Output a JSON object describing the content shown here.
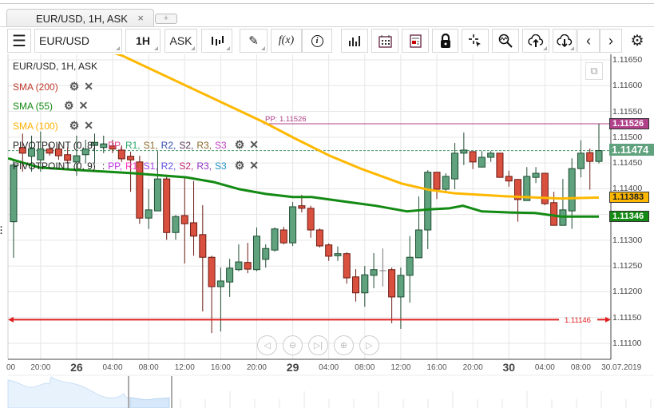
{
  "tab": {
    "title": "EUR/USD, 1H, ASK",
    "close": "×",
    "new": "+"
  },
  "toolbar": {
    "symbol": "EUR/USD",
    "timeframe": "1H",
    "side": "ASK",
    "fx": "f(x)",
    "icons": [
      "menu-icon",
      "candlestick-icon",
      "pencil-icon",
      "function-icon",
      "info-icon",
      "bar-chart-icon",
      "calendar-icon",
      "news-icon",
      "lock-icon",
      "crosshair-icon",
      "zoom-chart-icon",
      "upload-cloud-icon",
      "download-cloud-icon",
      "chevron-left-icon",
      "chevron-right-icon",
      "gear-icon"
    ]
  },
  "legend": {
    "title": "EUR/USD, 1H, ASK",
    "sma200": "SMA (200)",
    "sma55": "SMA (55)",
    "sma100": "SMA (100)",
    "pivot1": {
      "name": "PIVOTPOINT (0, 8)",
      "sep": ":",
      "items": [
        "PP,",
        "R1,",
        "S1,",
        "R2,",
        "S2,",
        "R3,",
        "S3"
      ],
      "colors": [
        "#e0408a",
        "#2aa86b",
        "#8a6a2a",
        "#3a4fb0",
        "#5a3a5a",
        "#8a6a2a",
        "#c040c0"
      ]
    },
    "pivot2": {
      "name": "PIVOTPOINT (0, 9)",
      "sep": ":",
      "items": [
        "PP,",
        "R1,",
        "S1,",
        "R2,",
        "S2,",
        "R3,",
        "S3"
      ],
      "colors": [
        "#c030e0",
        "#ff30c0",
        "#a040e0",
        "#6050e0",
        "#c02070",
        "#9030c0",
        "#2090c0"
      ]
    },
    "gear": "⚙",
    "close": "✕"
  },
  "colors": {
    "up": "#5fa27d",
    "down": "#d9503f",
    "sma100": "#ffb800",
    "sma55": "#138a13",
    "pp": "#b0408a",
    "support": "#e02020"
  },
  "chart": {
    "price_labels": [
      "1.11650",
      "1.11600",
      "1.11550",
      "1.11500",
      "1.11450",
      "1.11400",
      "1.11300",
      "1.11250",
      "1.11200",
      "1.11150",
      "1.11100"
    ],
    "time_labels": [
      {
        "t": "00",
        "i": -1.6
      },
      {
        "t": "20:00",
        "i": 3
      },
      {
        "t": "26",
        "i": 7,
        "bold": true
      },
      {
        "t": "04:00",
        "i": 11
      },
      {
        "t": "08:00",
        "i": 15
      },
      {
        "t": "12:00",
        "i": 19
      },
      {
        "t": "16:00",
        "i": 23
      },
      {
        "t": "20:00",
        "i": 27
      },
      {
        "t": "29",
        "i": 31,
        "bold": true
      },
      {
        "t": "04:00",
        "i": 35
      },
      {
        "t": "08:00",
        "i": 39
      },
      {
        "t": "12:00",
        "i": 43
      },
      {
        "t": "16:00",
        "i": 47
      },
      {
        "t": "20:00",
        "i": 51
      },
      {
        "t": "30",
        "i": 55,
        "bold": true
      },
      {
        "t": "04:00",
        "i": 59
      },
      {
        "t": "08:00",
        "i": 63
      },
      {
        "t": "30.07.2019",
        "i": 67.5
      }
    ],
    "last_price": "1.11474",
    "pp_value": "1.11526",
    "pp_label": "PP: 1.11526",
    "sma100_value": "1.11383",
    "sma55_value": "1.11346",
    "support_value": "1.11146",
    "candles_ohlc": [
      [
        1.11336,
        1.11456,
        1.11266,
        1.11446
      ],
      [
        1.1148,
        1.11507,
        1.11433,
        1.11469
      ],
      [
        1.11463,
        1.11503,
        1.11433,
        1.11478
      ],
      [
        1.11456,
        1.11511,
        1.11433,
        1.11477
      ],
      [
        1.11477,
        1.11487,
        1.11464,
        1.11469
      ],
      [
        1.11477,
        1.11487,
        1.11456,
        1.11464
      ],
      [
        1.11466,
        1.1148,
        1.11449,
        1.11455
      ],
      [
        1.11452,
        1.11503,
        1.11425,
        1.11464
      ],
      [
        1.11466,
        1.11495,
        1.11449,
        1.11477
      ],
      [
        1.11484,
        1.11507,
        1.11449,
        1.1149
      ],
      [
        1.1148,
        1.11503,
        1.11469,
        1.11487
      ],
      [
        1.11483,
        1.11495,
        1.11469,
        1.11477
      ],
      [
        1.11475,
        1.11484,
        1.11452,
        1.11458
      ],
      [
        1.11463,
        1.11472,
        1.11394,
        1.11456
      ],
      [
        1.11452,
        1.11464,
        1.11332,
        1.11343
      ],
      [
        1.11343,
        1.11399,
        1.11322,
        1.11359
      ],
      [
        1.11357,
        1.11473,
        1.11357,
        1.11419
      ],
      [
        1.11419,
        1.11425,
        1.11301,
        1.11315
      ],
      [
        1.11315,
        1.11349,
        1.11301,
        1.11346
      ],
      [
        1.11348,
        1.11422,
        1.11255,
        1.11332
      ],
      [
        1.11334,
        1.11415,
        1.1127,
        1.11308
      ],
      [
        1.11311,
        1.11368,
        1.11162,
        1.11267
      ],
      [
        1.11267,
        1.1127,
        1.1112,
        1.1121
      ],
      [
        1.1121,
        1.11247,
        1.11123,
        1.11221
      ],
      [
        1.11219,
        1.11264,
        1.1119,
        1.11246
      ],
      [
        1.11243,
        1.11292,
        1.1124,
        1.11258
      ],
      [
        1.11257,
        1.11295,
        1.11236,
        1.11244
      ],
      [
        1.11243,
        1.11325,
        1.1124,
        1.11308
      ],
      [
        1.11263,
        1.11292,
        1.11247,
        1.11284
      ],
      [
        1.11281,
        1.11325,
        1.11278,
        1.11322
      ],
      [
        1.1132,
        1.11326,
        1.11292,
        1.11295
      ],
      [
        1.11295,
        1.11374,
        1.11289,
        1.11365
      ],
      [
        1.11367,
        1.11388,
        1.11354,
        1.11362
      ],
      [
        1.11362,
        1.11367,
        1.11305,
        1.1132
      ],
      [
        1.1132,
        1.11323,
        1.11286,
        1.11289
      ],
      [
        1.11291,
        1.11294,
        1.1126,
        1.11269
      ],
      [
        1.1127,
        1.11288,
        1.1126,
        1.11274
      ],
      [
        1.11274,
        1.11277,
        1.11216,
        1.11227
      ],
      [
        1.11229,
        1.11244,
        1.11181,
        1.11198
      ],
      [
        1.11198,
        1.1125,
        1.11171,
        1.11233
      ],
      [
        1.11232,
        1.11275,
        1.11207,
        1.11243
      ],
      [
        1.11241,
        1.11284,
        1.1121,
        1.11241
      ],
      [
        1.11243,
        1.11247,
        1.11139,
        1.1119
      ],
      [
        1.1119,
        1.11247,
        1.11128,
        1.11232
      ],
      [
        1.11232,
        1.11308,
        1.11179,
        1.11267
      ],
      [
        1.11266,
        1.11385,
        1.11266,
        1.1132
      ],
      [
        1.1132,
        1.11436,
        1.11283,
        1.11432
      ],
      [
        1.11432,
        1.11432,
        1.1138,
        1.11399
      ],
      [
        1.11399,
        1.1143,
        1.11394,
        1.11424
      ],
      [
        1.11419,
        1.11489,
        1.11399,
        1.11469
      ],
      [
        1.11469,
        1.11509,
        1.11446,
        1.11475
      ],
      [
        1.11472,
        1.11472,
        1.11438,
        1.11452
      ],
      [
        1.11442,
        1.11473,
        1.11442,
        1.11461
      ],
      [
        1.11461,
        1.11473,
        1.11452,
        1.11469
      ],
      [
        1.11469,
        1.11469,
        1.11422,
        1.11422
      ],
      [
        1.11424,
        1.11435,
        1.11404,
        1.11415
      ],
      [
        1.11418,
        1.11418,
        1.11336,
        1.11379
      ],
      [
        1.11377,
        1.11442,
        1.11377,
        1.11424
      ],
      [
        1.11422,
        1.11442,
        1.11411,
        1.1143
      ],
      [
        1.1143,
        1.1143,
        1.11368,
        1.11371
      ],
      [
        1.11373,
        1.11394,
        1.11329,
        1.11329
      ],
      [
        1.11329,
        1.11419,
        1.11329,
        1.11359
      ],
      [
        1.11357,
        1.11459,
        1.11322,
        1.11439
      ],
      [
        1.11439,
        1.11494,
        1.11422,
        1.11469
      ],
      [
        1.1147,
        1.11478,
        1.11398,
        1.11453
      ],
      [
        1.11453,
        1.11526,
        1.11449,
        1.11474
      ]
    ],
    "sma100": [
      [
        10.9,
        1.11665
      ],
      [
        12.1,
        1.11658
      ],
      [
        27.8,
        1.11529
      ],
      [
        31.3,
        1.11497
      ],
      [
        32.8,
        1.11484
      ],
      [
        35.1,
        1.11464
      ],
      [
        38.7,
        1.11438
      ],
      [
        43.1,
        1.1141
      ],
      [
        46.1,
        1.11398
      ],
      [
        49,
        1.11391
      ],
      [
        55,
        1.11385
      ],
      [
        60.8,
        1.11381
      ],
      [
        65,
        1.11383
      ]
    ],
    "sma55": [
      [
        -0.6,
        1.11459
      ],
      [
        2.9,
        1.11441
      ],
      [
        7.4,
        1.11436
      ],
      [
        13.3,
        1.1143
      ],
      [
        19.2,
        1.11422
      ],
      [
        22.2,
        1.11413
      ],
      [
        25.1,
        1.11399
      ],
      [
        28,
        1.1139
      ],
      [
        31,
        1.11384
      ],
      [
        33.1,
        1.11384
      ],
      [
        37.2,
        1.11374
      ],
      [
        40.2,
        1.11367
      ],
      [
        43.7,
        1.11356
      ],
      [
        46.1,
        1.1136
      ],
      [
        48.4,
        1.11362
      ],
      [
        49.9,
        1.11367
      ],
      [
        52,
        1.11356
      ],
      [
        55,
        1.11354
      ],
      [
        57.9,
        1.11353
      ],
      [
        60.8,
        1.11346
      ],
      [
        65,
        1.11346
      ]
    ],
    "ylim": [
      1.1108,
      1.11666
    ]
  },
  "nav_buttons": [
    "◁",
    "⊖",
    "▷|",
    "⊕",
    "▷"
  ]
}
